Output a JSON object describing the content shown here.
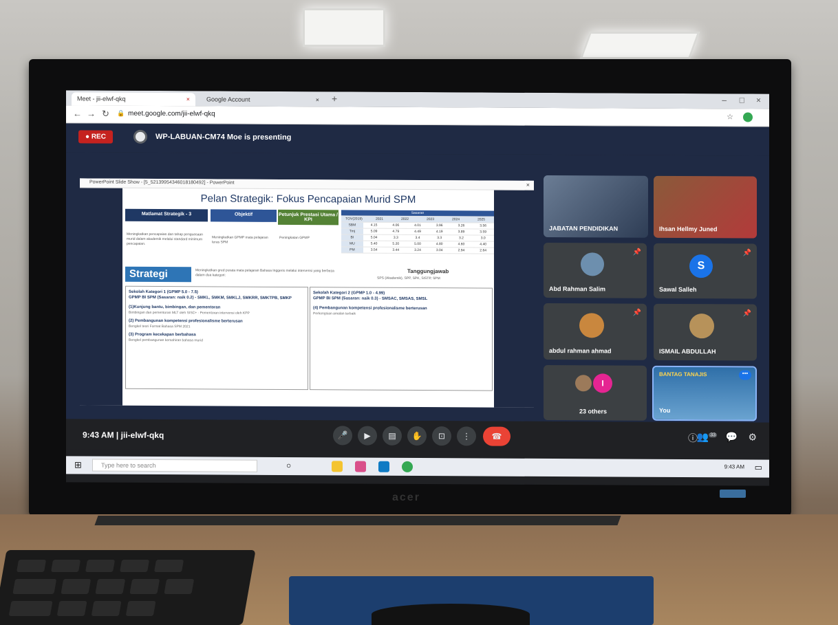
{
  "browser": {
    "tabs": [
      {
        "label": "Meet - jii-elwf-qkq",
        "close": "×"
      },
      {
        "label": "Google Account",
        "close": "×"
      }
    ],
    "new_tab": "+",
    "url": "meet.google.com/jii-elwf-qkq",
    "window_controls": [
      "–",
      "□",
      "×"
    ]
  },
  "meet": {
    "rec_label": "REC",
    "presenting_text": "WP-LABUAN-CM74 Moe is presenting",
    "time": "9:43 AM",
    "meeting_code": "jii-elwf-qkq",
    "participant_count": "33"
  },
  "powerpoint": {
    "title": "PowerPoint Slide Show - [5_52139954346018180492] - PowerPoint",
    "slide_title": "Pelan Strategik: Fokus Pencapaian Murid SPM",
    "headers": [
      "Matlamat Strategik - 3",
      "Objektif",
      "Petunjuk Prestasi Utama / KPI",
      "Sasaran"
    ],
    "table": {
      "columns": [
        "TOV(2019)",
        "2021",
        "2022",
        "2023",
        "2024",
        "2025"
      ],
      "rows": [
        [
          "SBM",
          "4.15",
          "4.06",
          "4.01",
          "3.96",
          "3.26",
          "3.56"
        ],
        [
          "Tmj",
          "5.09",
          "4.79",
          "4.49",
          "4.19",
          "3.89",
          "3.59"
        ],
        [
          "BI",
          "5.04",
          "3.3",
          "3.4",
          "3.3",
          "3.2",
          "3.0"
        ],
        [
          "MU",
          "5.40",
          "5.20",
          "5.00",
          "4.80",
          "4.60",
          "4.40"
        ],
        [
          "PM",
          "3.54",
          "3.44",
          "3.24",
          "3.04",
          "2.94",
          "2.64"
        ]
      ]
    },
    "matlamat_text": "Meningkatkan pencapaian dan tahap penguasaan murid dalam akademik melalui standard minimum pencapaian.",
    "objektif_text": "Meningkatkan GPMP mata pelajaran teras SPM",
    "kpi_text": "Peningkatan GPMP",
    "strategi_label": "Strategi",
    "strategi_text": "Meningkatkan gred purata mata pelajaran Bahasa Inggeris melalui intervensi yang berbeza dalam dua kategori:",
    "tanggungjawab_label": "Tanggungjawab",
    "tanggungjawab_text": "SPS (Akademik), SPP, SPK, SISTP, SPM",
    "box1": {
      "title": "Sekolah Kategori 1 (GPMP 5.0 - 7.5)",
      "subtitle": "GPMP BI SPM (Sasaran: naik 0.2) - SMKL, SMKM, SMKLJ, SMKRR, SMKTPB, SMKP",
      "items": [
        {
          "head": "(1)Kunjung bantu, bimbingan, dan pementoran",
          "sub": "Bimbingan dan pementoran MLT oleh SISC+ · Pementoran intervensi oleh KPP"
        },
        {
          "head": "(2) Pembangunan kompetensi profesionalisme berterusan",
          "sub": "Bengkel teori Format Bahasa SPM 2021"
        },
        {
          "head": "(3) Program kecekapan berbahasa",
          "sub": "Bengkel pembangunan kemahiran bahasa murid"
        }
      ]
    },
    "box2": {
      "title": "Sekolah Kategori 2 (GPMP 1.0 - 4.99)",
      "subtitle": "GPMP BI SPM (Sasaran: naik 0.3) - SMSAC, SMSAS, SMSL",
      "items": [
        {
          "head": "(4) Pembangunan kompetensi profesionalisme berterusan",
          "sub": "Perkongsian amalan terbaik"
        }
      ]
    }
  },
  "participants": [
    {
      "name": "JABATAN PENDIDIKAN"
    },
    {
      "name": "Ihsan Hellmy Juned"
    },
    {
      "name": "Abd Rahman Salim"
    },
    {
      "name": "Sawal Salleh",
      "initial": "S"
    },
    {
      "name": "abdul rahman ahmad"
    },
    {
      "name": "ISMAIL ABDULLAH"
    },
    {
      "name": "23 others",
      "initial": "I"
    },
    {
      "name": "You",
      "banner": "BANTAG TANAJIS"
    }
  ],
  "taskbar": {
    "search_placeholder": "Type here to search",
    "time": "9:43 AM"
  },
  "monitor": {
    "brand": "acer"
  },
  "colors": {
    "rec": "#c5221f",
    "end_call": "#ea4335",
    "meet_bg": "#202124",
    "slide_blue": "#2e5597"
  }
}
